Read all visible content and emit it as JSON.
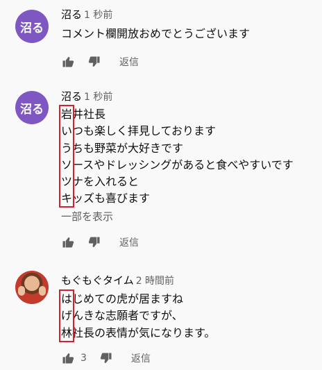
{
  "comments": [
    {
      "avatar_text": "沼る",
      "author": "沼る",
      "time": "1 秒前",
      "lines": [
        "コメント欄開放おめでとうございます"
      ],
      "like_count": "",
      "reply_label": "返信"
    },
    {
      "avatar_text": "沼る",
      "author": "沼る",
      "time": "1 秒前",
      "lines": [
        "岩井社長",
        "いつも楽しく拝見しております",
        "うちも野菜が大好きです",
        "ソースやドレッシングがあると食べやすいです",
        "ツナを入れると",
        "キッズも喜びます"
      ],
      "show_more": "一部を表示",
      "like_count": "",
      "reply_label": "返信"
    },
    {
      "author": "もぐもぐタイム",
      "time": "2 時間前",
      "lines": [
        "はじめての虎が居ますね",
        "げんきな志願者ですが、",
        "林社長の表情が気になります。"
      ],
      "like_count": "3",
      "reply_label": "返信"
    }
  ],
  "colors": {
    "avatar": "#7e57c2",
    "highlight": "#d4202a",
    "secondary_text": "#606060"
  },
  "icons": [
    "thumbs-up-icon",
    "thumbs-down-icon"
  ]
}
